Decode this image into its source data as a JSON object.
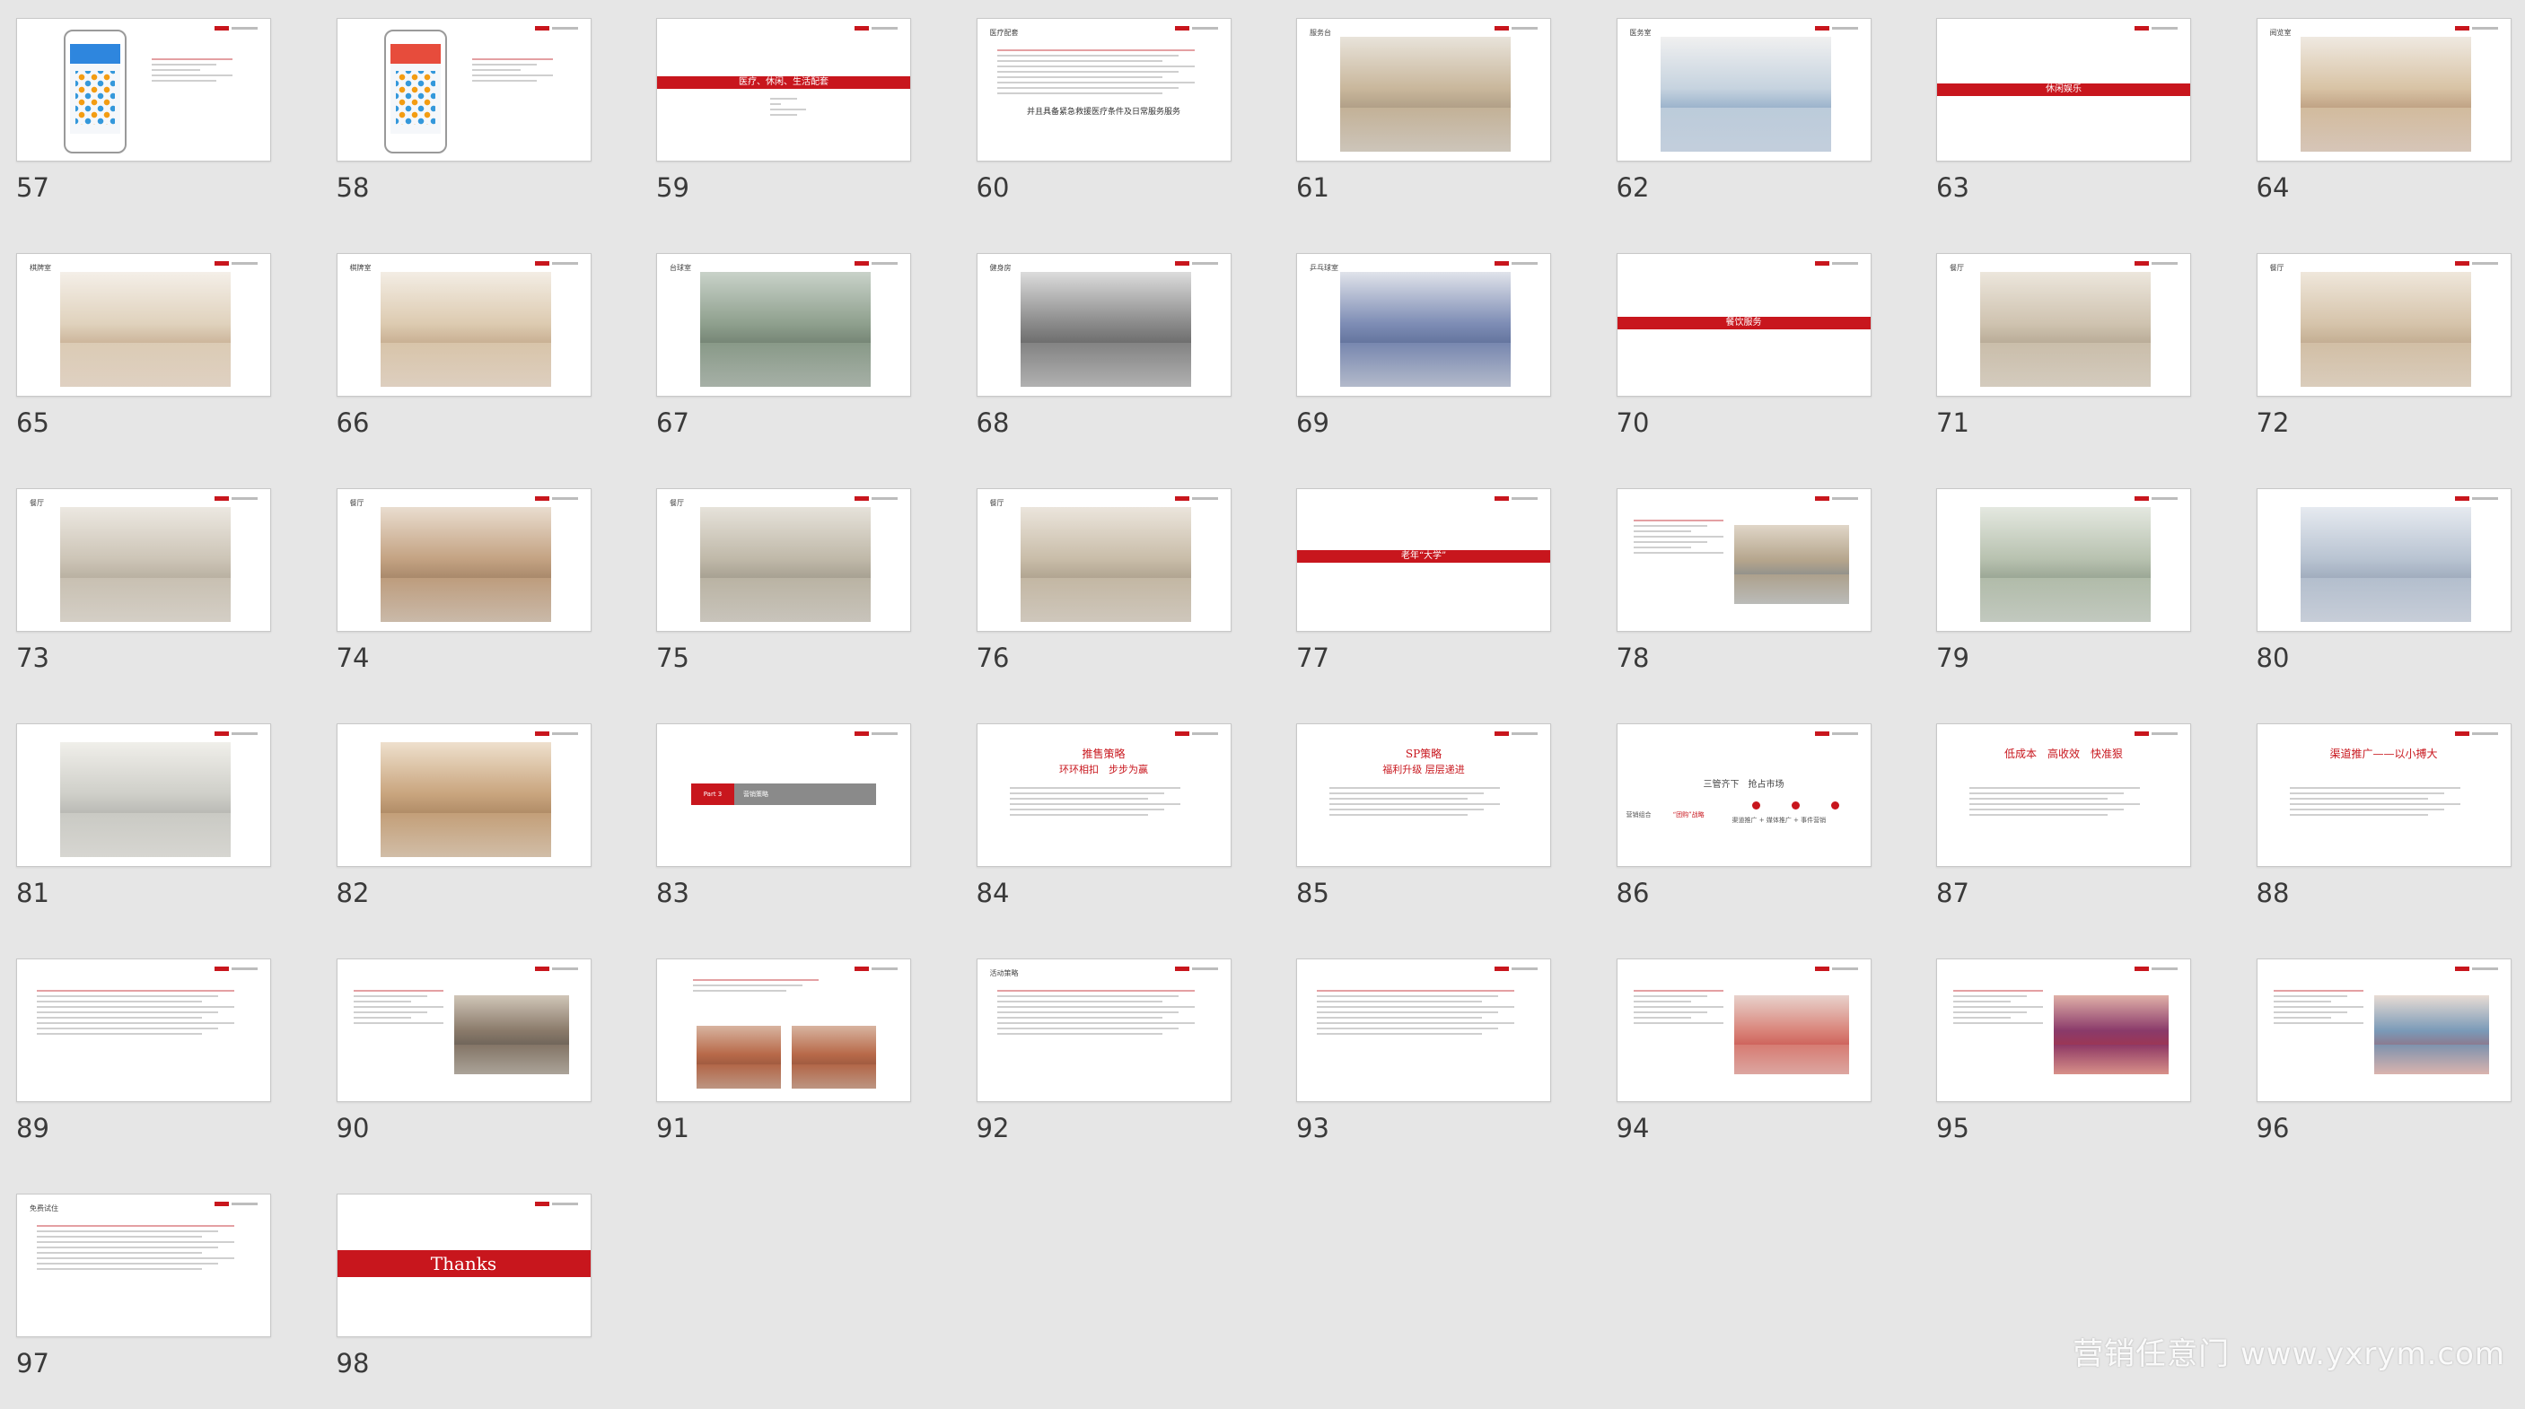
{
  "watermark": "营销任意门 www.yxrym.com",
  "slides": [
    {
      "num": "57",
      "kind": "phone",
      "hdr": "#2e86de",
      "title": "",
      "band": ""
    },
    {
      "num": "58",
      "kind": "phone",
      "hdr": "#e74c3c",
      "title": "",
      "band": ""
    },
    {
      "num": "59",
      "kind": "band",
      "band": "医疗、休闲、生活配套",
      "bandTop": 64,
      "title": ""
    },
    {
      "num": "60",
      "kind": "text",
      "title": "医疗配套",
      "headline": "并且具备紧急救援医疗条件及日常服务服务"
    },
    {
      "num": "61",
      "kind": "photo",
      "title": "服务台",
      "tone": [
        "#7a6a58",
        "#c9b79c",
        "#e8e3da"
      ]
    },
    {
      "num": "62",
      "kind": "photo",
      "title": "医务室",
      "tone": [
        "#3b6aa0",
        "#c6d3df",
        "#f0f0f0"
      ]
    },
    {
      "num": "63",
      "kind": "band",
      "band": "休闲娱乐",
      "bandTop": 72,
      "title": ""
    },
    {
      "num": "64",
      "kind": "photo",
      "title": "阅览室",
      "tone": [
        "#8b5a3c",
        "#d8c3a5",
        "#efe9e1"
      ]
    },
    {
      "num": "65",
      "kind": "photo",
      "title": "棋牌室",
      "tone": [
        "#a0764f",
        "#e0d2bd",
        "#f4efe8"
      ]
    },
    {
      "num": "66",
      "kind": "photo",
      "title": "棋牌室",
      "tone": [
        "#9b7350",
        "#ddcbb1",
        "#f3ede4"
      ]
    },
    {
      "num": "67",
      "kind": "photo",
      "title": "台球室",
      "tone": [
        "#3d4a3f",
        "#8fa08e",
        "#c9d2c9"
      ]
    },
    {
      "num": "68",
      "kind": "photo",
      "title": "健身房",
      "tone": [
        "#2f2f2f",
        "#8a8a8a",
        "#dcdcdc"
      ]
    },
    {
      "num": "69",
      "kind": "photo",
      "title": "乒乓球室",
      "tone": [
        "#2b3e6b",
        "#7e8db5",
        "#e0e3ea"
      ]
    },
    {
      "num": "70",
      "kind": "band",
      "band": "餐饮服务",
      "bandTop": 70,
      "title": ""
    },
    {
      "num": "71",
      "kind": "photo",
      "title": "餐厅",
      "tone": [
        "#8a7a62",
        "#cfc3b0",
        "#ece6dc"
      ]
    },
    {
      "num": "72",
      "kind": "photo",
      "title": "餐厅",
      "tone": [
        "#9a7c5d",
        "#d6c4ab",
        "#efe7db"
      ]
    },
    {
      "num": "73",
      "kind": "photo",
      "title": "餐厅",
      "tone": [
        "#8c8272",
        "#cdc5b7",
        "#ece8e1"
      ]
    },
    {
      "num": "74",
      "kind": "photo",
      "title": "餐厅",
      "tone": [
        "#6b4e36",
        "#c4a383",
        "#e9ddcf"
      ]
    },
    {
      "num": "75",
      "kind": "photo",
      "title": "餐厅",
      "tone": [
        "#6f6a5e",
        "#c0b9a9",
        "#e6e2da"
      ]
    },
    {
      "num": "76",
      "kind": "photo",
      "title": "餐厅",
      "tone": [
        "#7a6d5b",
        "#c9bda9",
        "#ebe5dc"
      ]
    },
    {
      "num": "77",
      "kind": "band",
      "band": "老年“大学”",
      "bandTop": 68,
      "title": ""
    },
    {
      "num": "78",
      "kind": "textphoto",
      "title": "",
      "tone": [
        "#4b6b8a",
        "#b5a58c",
        "#e0d6c8"
      ]
    },
    {
      "num": "79",
      "kind": "photo",
      "title": "",
      "tone": [
        "#5a6a5a",
        "#b8c2b0",
        "#e4e8e0"
      ]
    },
    {
      "num": "80",
      "kind": "photo",
      "title": "",
      "tone": [
        "#6a7890",
        "#b9c4d2",
        "#e6eaf0"
      ]
    },
    {
      "num": "81",
      "kind": "photo",
      "title": "",
      "tone": [
        "#8a8a86",
        "#cfcfc9",
        "#f0efea"
      ]
    },
    {
      "num": "82",
      "kind": "photo",
      "title": "",
      "tone": [
        "#7a5535",
        "#c9a57e",
        "#eee0cd"
      ]
    },
    {
      "num": "83",
      "kind": "graybar",
      "title": "",
      "bar_left": "Part 3",
      "bar_right": "营销策略"
    },
    {
      "num": "84",
      "kind": "headline",
      "title": "",
      "headline": "推售策略",
      "sub": "环环相扣　步步为赢"
    },
    {
      "num": "85",
      "kind": "headline",
      "title": "",
      "headline": "SP策略",
      "sub": "福利升级 层层递进"
    },
    {
      "num": "86",
      "kind": "dots",
      "title": "",
      "headline": "三管齐下　抢占市场",
      "left": "营销组合",
      "mid": "“团购”战略",
      "right": "渠道推广 + 媒体推广 + 事件营销"
    },
    {
      "num": "87",
      "kind": "headline",
      "title": "",
      "headline": "低成本　高收效　快准狠",
      "sub": ""
    },
    {
      "num": "88",
      "kind": "headline",
      "title": "",
      "headline": "渠道推广——以小搏大",
      "sub": ""
    },
    {
      "num": "89",
      "kind": "text",
      "title": "",
      "headline": ""
    },
    {
      "num": "90",
      "kind": "textphoto",
      "title": "",
      "tone": [
        "#3a3a3a",
        "#8a7a6a",
        "#d0c6b8"
      ]
    },
    {
      "num": "91",
      "kind": "twophoto",
      "title": "",
      "tone": [
        "#6b3a2a",
        "#b86a4a",
        "#d8b4a0"
      ]
    },
    {
      "num": "92",
      "kind": "text",
      "title": "活动策略",
      "headline": ""
    },
    {
      "num": "93",
      "kind": "text",
      "title": "",
      "headline": ""
    },
    {
      "num": "94",
      "kind": "textphoto",
      "title": "",
      "tone": [
        "#b8201e",
        "#d9847a",
        "#e8d2cc"
      ]
    },
    {
      "num": "95",
      "kind": "textphoto",
      "title": "",
      "tone": [
        "#c0302a",
        "#8a3a6a",
        "#e0b0a8"
      ]
    },
    {
      "num": "96",
      "kind": "textphoto",
      "title": "",
      "tone": [
        "#b03a3a",
        "#7a9ab8",
        "#e8dcd4"
      ]
    },
    {
      "num": "97",
      "kind": "text",
      "title": "免费试住",
      "headline": ""
    },
    {
      "num": "98",
      "kind": "band",
      "band": "Thanks",
      "bandTop": 66,
      "title": ""
    }
  ],
  "colors": {
    "accent": "#c8161d",
    "background": "#e6e6e6",
    "slide": "#ffffff"
  }
}
